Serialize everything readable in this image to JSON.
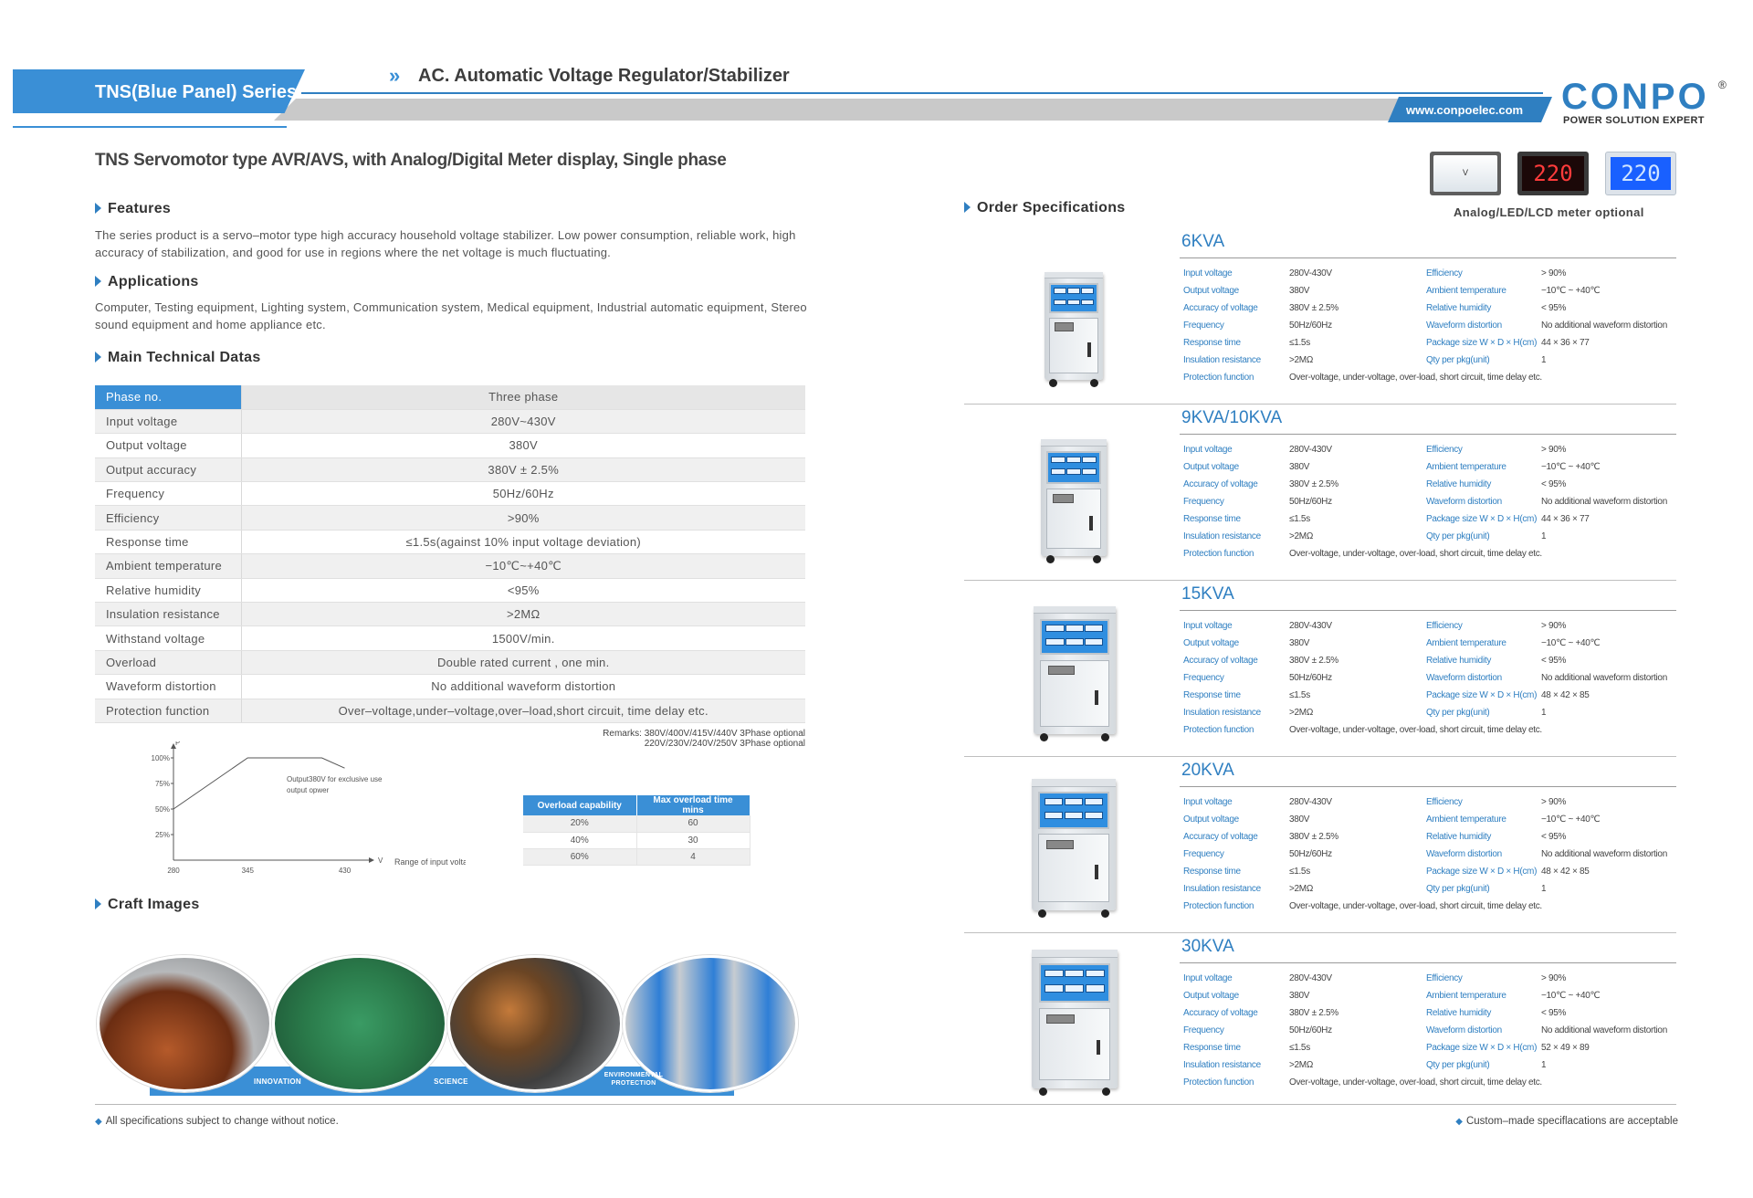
{
  "header": {
    "series": "TNS(Blue Panel) Series",
    "chevrons": "»",
    "title": "AC. Automatic Voltage Regulator/Stabilizer",
    "url": "www.conpoelec.com",
    "logo_text": "CONPO",
    "logo_registered": "®",
    "logo_tagline": "POWER SOLUTION EXPERT"
  },
  "page_title": "TNS  Servomotor type AVR/AVS, with Analog/Digital Meter display, Single phase",
  "meters": {
    "analog_face": "V",
    "led_value": "220",
    "lcd_value": "220",
    "caption": "Analog/LED/LCD meter optional"
  },
  "features": {
    "heading": "Features",
    "text": "The series product is a servo–motor type high accuracy household voltage stabilizer. Low power consumption, reliable work, high accuracy of stabilization, and good for use in regions where the net voltage is much fluctuating."
  },
  "applications": {
    "heading": "Applications",
    "text": "Computer, Testing equipment, Lighting system, Communication system, Medical equipment, Industrial automatic equipment, Stereo sound equipment and home appliance  etc."
  },
  "tech": {
    "heading": "Main Technical Datas",
    "rows": [
      [
        "Phase no.",
        "Three phase"
      ],
      [
        "Input voltage",
        "280V~430V"
      ],
      [
        "Output voltage",
        "380V"
      ],
      [
        "Output accuracy",
        "380V ± 2.5%"
      ],
      [
        "Frequency",
        "50Hz/60Hz"
      ],
      [
        "Efficiency",
        ">90%"
      ],
      [
        "Response time",
        "≤1.5s(against 10% input voltage deviation)"
      ],
      [
        "Ambient temperature",
        "−10℃~+40℃"
      ],
      [
        "Relative humidity",
        "<95%"
      ],
      [
        "Insulation resistance",
        ">2MΩ"
      ],
      [
        "Withstand voltage",
        "1500V/min."
      ],
      [
        "Overload",
        "Double rated current , one min."
      ],
      [
        "Waveform distortion",
        "No additional waveform distortion"
      ],
      [
        "Protection function",
        "Over–voltage,under–voltage,over–load,short circuit, time delay etc."
      ]
    ],
    "remarks_1": "Remarks: 380V/400V/415V/440V 3Phase optional",
    "remarks_2": "220V/230V/240V/250V 3Phase optional"
  },
  "chart_data": {
    "type": "line",
    "title": "",
    "xlabel": "Range of input voltage",
    "ylabel": "P",
    "x_unit": "V",
    "x_ticks": [
      "280",
      "345",
      "430"
    ],
    "y_ticks": [
      "25%",
      "50%",
      "75%",
      "100%"
    ],
    "series": [
      {
        "x": [
          280,
          345,
          410,
          430
        ],
        "y": [
          50,
          100,
          100,
          90
        ]
      }
    ],
    "xlim": [
      280,
      440
    ],
    "ylim": [
      0,
      100
    ],
    "annotation": [
      "Output380V for exclusive use",
      "output opwer"
    ]
  },
  "overload_table": {
    "headers": [
      "Overload capability",
      "Max overload time mins"
    ],
    "rows": [
      [
        "20%",
        "60"
      ],
      [
        "40%",
        "30"
      ],
      [
        "60%",
        "4"
      ]
    ]
  },
  "craft": {
    "heading": "Craft Images",
    "labels": [
      "INNOVATION",
      "SCIENCE",
      "ENVIRONMENTAL",
      "PROTECTION"
    ]
  },
  "footer": {
    "left": "All specifications subject to change without notice.",
    "right": "Custom–made speciflacations are acceptable"
  },
  "order": {
    "heading": "Order Specifications",
    "labels_left": [
      "Input voltage",
      "Output voltage",
      "Accuracy of voltage",
      "Frequency",
      "Response time",
      "Insulation resistance",
      "Protection function"
    ],
    "labels_right": [
      "Efficiency",
      "Ambient temperature",
      "Relative humidity",
      "Waveform distortion",
      "Package size W × D × H(cm)",
      "Qty per pkg(unit)"
    ],
    "products": [
      {
        "name": "6KVA",
        "left": [
          "280V-430V",
          "380V",
          "380V ± 2.5%",
          "50Hz/60Hz",
          "≤1.5s",
          ">2MΩ",
          "Over-voltage, under-voltage, over-load, short circuit, time delay etc."
        ],
        "right": [
          "> 90%",
          "−10℃ ~ +40℃",
          "< 95%",
          "No additional waveform distortion",
          "44 × 36 × 77",
          "1"
        ]
      },
      {
        "name": "9KVA/10KVA",
        "left": [
          "280V-430V",
          "380V",
          "380V ± 2.5%",
          "50Hz/60Hz",
          "≤1.5s",
          ">2MΩ",
          "Over-voltage, under-voltage, over-load, short circuit, time delay etc."
        ],
        "right": [
          "> 90%",
          "−10℃ ~ +40℃",
          "< 95%",
          "No additional waveform distortion",
          "44 × 36 × 77",
          "1"
        ]
      },
      {
        "name": "15KVA",
        "left": [
          "280V-430V",
          "380V",
          "380V ± 2.5%",
          "50Hz/60Hz",
          "≤1.5s",
          ">2MΩ",
          "Over-voltage, under-voltage, over-load, short circuit, time delay etc."
        ],
        "right": [
          "> 90%",
          "−10℃ ~ +40℃",
          "< 95%",
          "No additional waveform distortion",
          "48 × 42 × 85",
          "1"
        ]
      },
      {
        "name": "20KVA",
        "left": [
          "280V-430V",
          "380V",
          "380V ± 2.5%",
          "50Hz/60Hz",
          "≤1.5s",
          ">2MΩ",
          "Over-voltage, under-voltage, over-load, short circuit, time delay etc."
        ],
        "right": [
          "> 90%",
          "−10℃ ~ +40℃",
          "< 95%",
          "No additional waveform distortion",
          "48 × 42 × 85",
          "1"
        ]
      },
      {
        "name": "30KVA",
        "left": [
          "280V-430V",
          "380V",
          "380V ± 2.5%",
          "50Hz/60Hz",
          "≤1.5s",
          ">2MΩ",
          "Over-voltage, under-voltage, over-load, short circuit, time delay etc."
        ],
        "right": [
          "> 90%",
          "−10℃ ~ +40℃",
          "< 95%",
          "No additional waveform distortion",
          "52 × 49 × 89",
          "1"
        ]
      }
    ]
  },
  "colors": {
    "accent": "#2f7fc1",
    "tab": "#3a8fd6",
    "band": "#c9c9c9"
  }
}
